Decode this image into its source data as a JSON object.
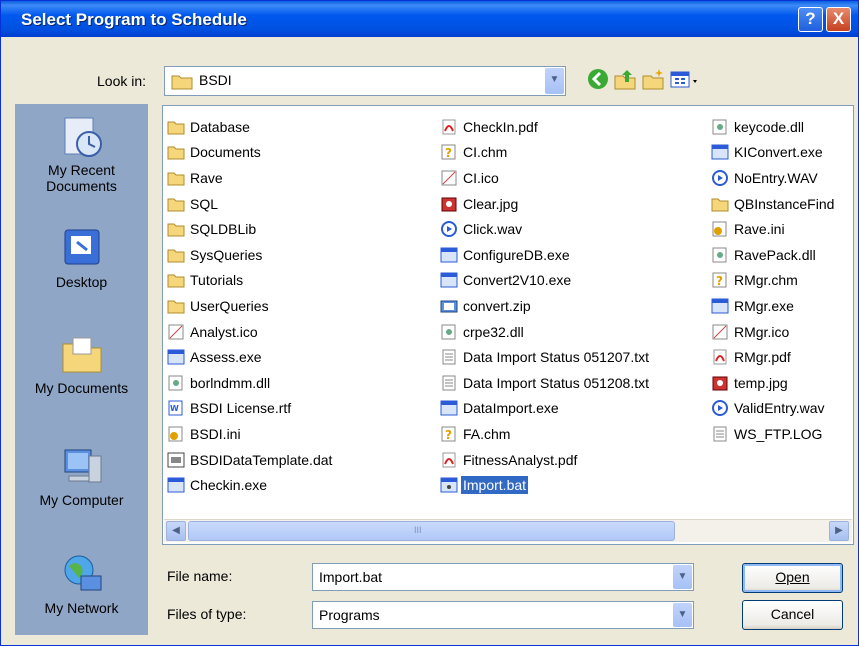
{
  "window": {
    "title": "Select Program to Schedule",
    "help_label": "?",
    "close_label": "X"
  },
  "lookin": {
    "label": "Look in:",
    "value": "BSDI"
  },
  "toolbar": {
    "back_icon": "back-icon",
    "up_icon": "up-folder-icon",
    "newfolder_icon": "new-folder-icon",
    "views_icon": "views-menu-icon"
  },
  "places": [
    {
      "label": "My Recent Documents",
      "icon": "recent-documents-icon"
    },
    {
      "label": "Desktop",
      "icon": "desktop-icon"
    },
    {
      "label": "My Documents",
      "icon": "my-documents-icon"
    },
    {
      "label": "My Computer",
      "icon": "my-computer-icon"
    },
    {
      "label": "My Network",
      "icon": "my-network-icon"
    }
  ],
  "files": {
    "col1": [
      "Database",
      "Documents",
      "Rave",
      "SQL",
      "SQLDBLib",
      "SysQueries",
      "Tutorials",
      "UserQueries",
      "Analyst.ico",
      "Assess.exe",
      "borlndmm.dll",
      "BSDI License.rtf",
      "BSDI.ini",
      "BSDIDataTemplate.dat",
      "Checkin.exe"
    ],
    "col2": [
      "CheckIn.pdf",
      "CI.chm",
      "CI.ico",
      "Clear.jpg",
      "Click.wav",
      "ConfigureDB.exe",
      "Convert2V10.exe",
      "convert.zip",
      "crpe32.dll",
      "Data Import Status 051207.txt",
      "Data Import Status 051208.txt",
      "DataImport.exe",
      "FA.chm",
      "FitnessAnalyst.pdf",
      "Import.bat"
    ],
    "col3": [
      "keycode.dll",
      "KIConvert.exe",
      "NoEntry.WAV",
      "QBInstanceFind",
      "Rave.ini",
      "RavePack.dll",
      "RMgr.chm",
      "RMgr.exe",
      "RMgr.ico",
      "RMgr.pdf",
      "temp.jpg",
      "ValidEntry.wav",
      "WS_FTP.LOG"
    ],
    "selected": "Import.bat"
  },
  "scrollbar": {
    "thumb_grip": "III"
  },
  "filename": {
    "label": "File name:",
    "value": "Import.bat"
  },
  "filetype": {
    "label": "Files of type:",
    "value": "Programs"
  },
  "buttons": {
    "open": "Open",
    "cancel": "Cancel"
  },
  "colors": {
    "titlebar": "#0054E3",
    "selection": "#316AC5",
    "places_bg": "#8FA6C6",
    "dialog_bg": "#ECE9D8"
  }
}
